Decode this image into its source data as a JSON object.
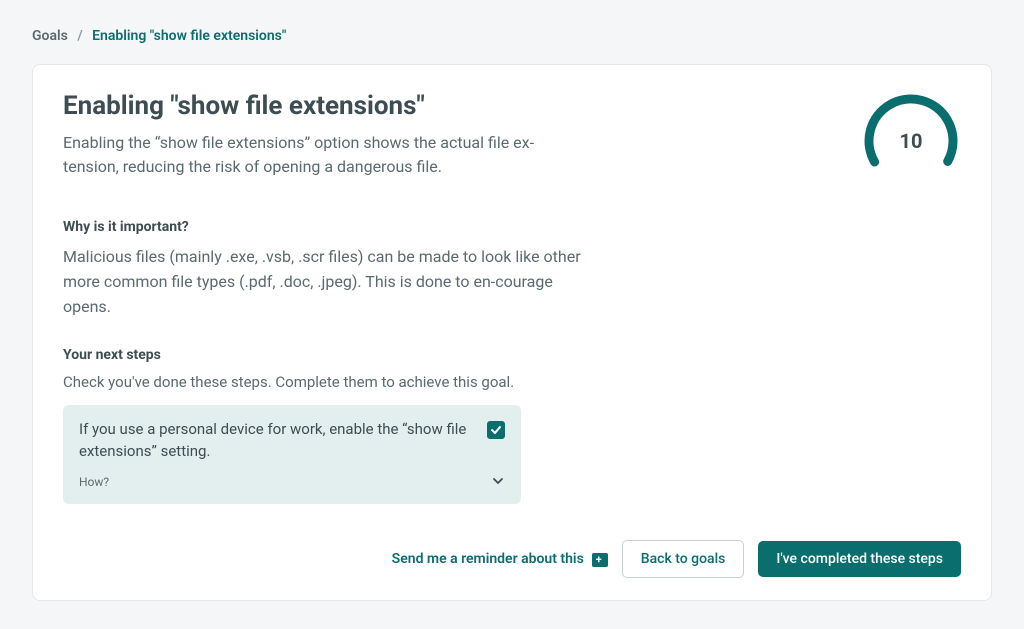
{
  "breadcrumb": {
    "root": "Goals",
    "sep": "/",
    "current": "Enabling \"show file extensions\""
  },
  "title": "Enabling \"show file extensions\"",
  "description": "Enabling the “show file extensions” option shows the actual file ex‐tension, reducing the risk of opening a dangerous file.",
  "gauge": {
    "value": "10"
  },
  "why_heading": "Why is it important?",
  "why_body": "Malicious files (mainly .exe, .vsb, .scr files) can be made to look like other more common file types (.pdf, .doc, .jpeg). This is done to en‐courage opens.",
  "steps_heading": "Your next steps",
  "steps_intro": "Check you've done these steps. Complete them to achieve this goal.",
  "step": {
    "text": "If you use a personal device for work, enable the “show file extensions” setting.",
    "how_label": "How?"
  },
  "footer": {
    "reminder": "Send me a reminder about this",
    "back": "Back to goals",
    "complete": "I've completed these steps"
  }
}
